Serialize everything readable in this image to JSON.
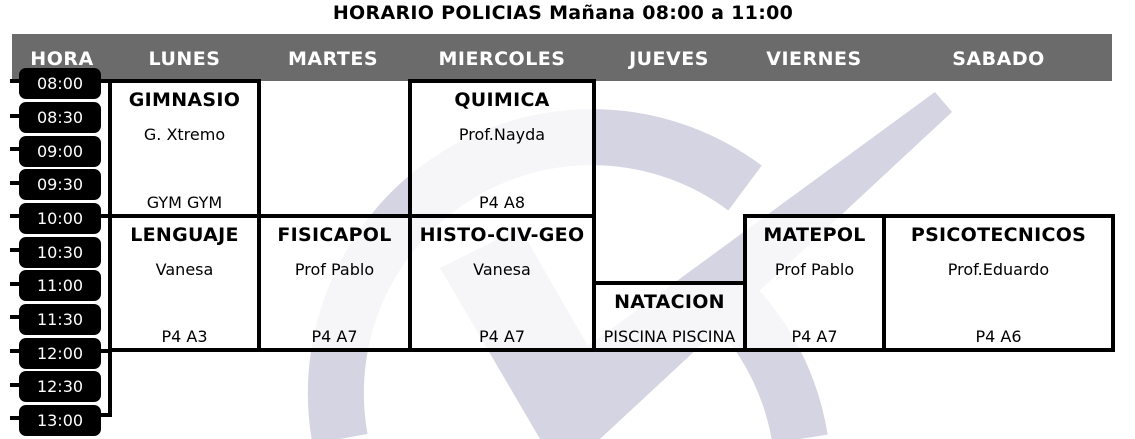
{
  "title": "HORARIO POLICIAS Mañana 08:00 a 11:00",
  "header": {
    "hora": "HORA",
    "days": [
      "LUNES",
      "MARTES",
      "MIERCOLES",
      "JUEVES",
      "VIERNES",
      "SABADO"
    ]
  },
  "hours": [
    "08:00",
    "08:30",
    "09:00",
    "09:30",
    "10:00",
    "10:30",
    "11:00",
    "11:30",
    "12:00",
    "12:30",
    "13:00"
  ],
  "classes": [
    {
      "subject": "GIMNASIO",
      "teacher": "G. Xtremo",
      "room": "GYM GYM",
      "day": "LUNES",
      "start": "08:00",
      "end": "10:00"
    },
    {
      "subject": "QUIMICA",
      "teacher": "Prof.Nayda",
      "room": "P4 A8",
      "day": "MIERCOLES",
      "start": "08:00",
      "end": "10:00"
    },
    {
      "subject": "LENGUAJE",
      "teacher": "Vanesa",
      "room": "P4 A3",
      "day": "LUNES",
      "start": "10:00",
      "end": "12:00"
    },
    {
      "subject": "FISICAPOL",
      "teacher": "Prof Pablo",
      "room": "P4 A7",
      "day": "MARTES",
      "start": "10:00",
      "end": "12:00"
    },
    {
      "subject": "HISTO-CIV-GEO",
      "teacher": "Vanesa",
      "room": "P4 A7",
      "day": "MIERCOLES",
      "start": "10:00",
      "end": "12:00"
    },
    {
      "subject": "NATACION",
      "teacher": "",
      "room": "PISCINA PISCINA",
      "day": "JUEVES",
      "start": "11:00",
      "end": "12:00"
    },
    {
      "subject": "MATEPOL",
      "teacher": "Prof Pablo",
      "room": "P4 A7",
      "day": "VIERNES",
      "start": "10:00",
      "end": "12:00"
    },
    {
      "subject": "PSICOTECNICOS",
      "teacher": "Prof.Eduardo",
      "room": "P4 A6",
      "day": "SABADO",
      "start": "10:00",
      "end": "12:00"
    }
  ],
  "colors": {
    "header_bg": "#6b6b6b",
    "watermark": "#d4d4e2"
  }
}
